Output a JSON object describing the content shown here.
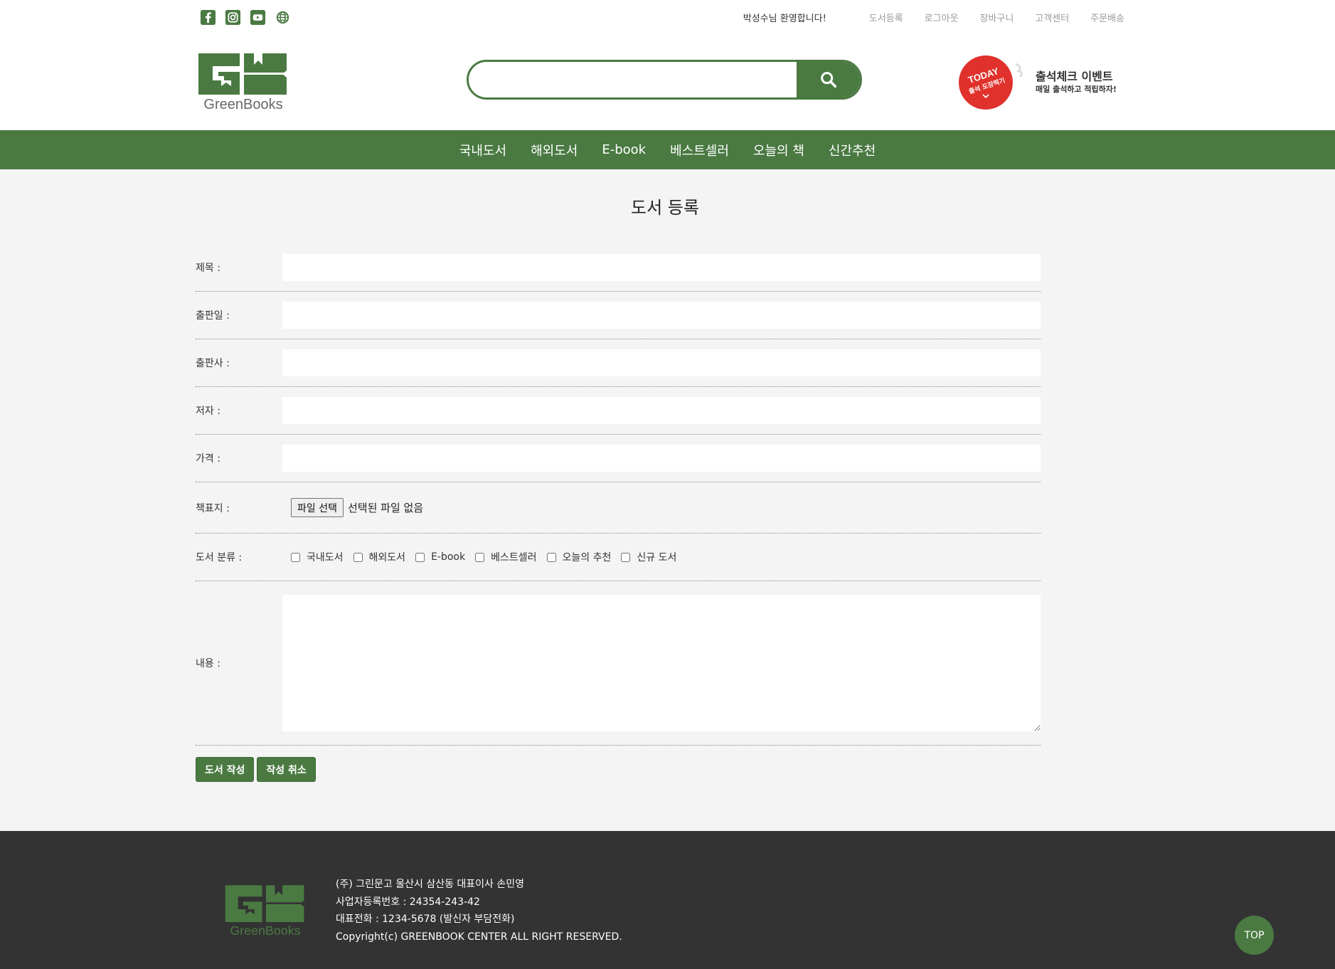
{
  "social": {
    "icons": [
      "facebook-icon",
      "instagram-icon",
      "youtube-icon",
      "globe-icon"
    ]
  },
  "topnav": {
    "welcome": "박성수님 환영합니다!",
    "links": [
      "도서등록",
      "로그아웃",
      "장바구니",
      "고객센터",
      "주문배송"
    ]
  },
  "logo": {
    "text": "GreenBooks",
    "mark": "GB"
  },
  "search": {
    "placeholder": "",
    "value": ""
  },
  "event": {
    "stamp_line1": "TODAY",
    "stamp_line2": "출석 도장찍기",
    "title": "출석체크 이벤트",
    "subtitle": "매일 출석하고 적립하자!"
  },
  "gnb": [
    "국내도서",
    "해외도서",
    "E-book",
    "베스트셀러",
    "오늘의 책",
    "신간추천"
  ],
  "page_title": "도서 등록",
  "form": {
    "fields": [
      {
        "label": "제목 :",
        "value": ""
      },
      {
        "label": "출판일 :",
        "value": ""
      },
      {
        "label": "출판사 :",
        "value": ""
      },
      {
        "label": "저자 :",
        "value": ""
      },
      {
        "label": "가격 :",
        "value": ""
      }
    ],
    "cover_label": "책표지 :",
    "file_button": "파일 선택",
    "file_status": "선택된 파일 없음",
    "category_label": "도서 분류 :",
    "categories": [
      "국내도서",
      "해외도서",
      "E-book",
      "베스트셀러",
      "오늘의 추천",
      "신규 도서"
    ],
    "content_label": "내용 :",
    "content_value": "",
    "submit": "도서 작성",
    "cancel": "작성 취소"
  },
  "footer": {
    "lines": [
      "(주) 그린문고 울산시 삼산동 대표이사 손민영",
      "사업자등록번호 : 24354-243-42",
      "대표전화 : 1234-5678 (발신자 부담전화)",
      "Copyright(c) GREENBOOK CENTER ALL RIGHT RESERVED."
    ],
    "logo_text": "GreenBooks"
  },
  "top_button": "TOP",
  "colors": {
    "brand": "#4a7a42",
    "footer_bg": "#333333",
    "event_red": "#e0312c"
  }
}
